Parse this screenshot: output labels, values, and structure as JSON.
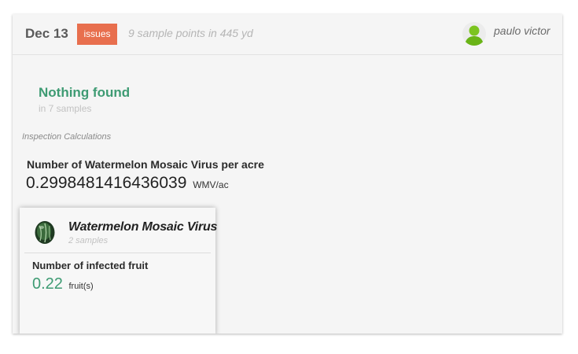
{
  "header": {
    "date": "Dec 13",
    "badge": "issues",
    "summary": "9 sample points in 445 yd",
    "username": "paulo victor"
  },
  "status": {
    "title": "Nothing found",
    "subtitle": "in 7 samples"
  },
  "calculations": {
    "section_label": "Inspection Calculations",
    "metric_label": "Number of Watermelon Mosaic Virus per acre",
    "metric_value": "0.2998481416436039",
    "metric_unit": "WMV/ac"
  },
  "pest_card": {
    "name": "Watermelon Mosaic Virus",
    "samples": "2 samples",
    "metric_label": "Number of infected fruit",
    "metric_value": "0.22",
    "metric_unit": "fruit(s)",
    "icon": "watermelon-fruit-icon"
  },
  "colors": {
    "badge": "#e86f4e",
    "accent_green": "#3e9b73",
    "avatar_green": "#7cc420"
  }
}
